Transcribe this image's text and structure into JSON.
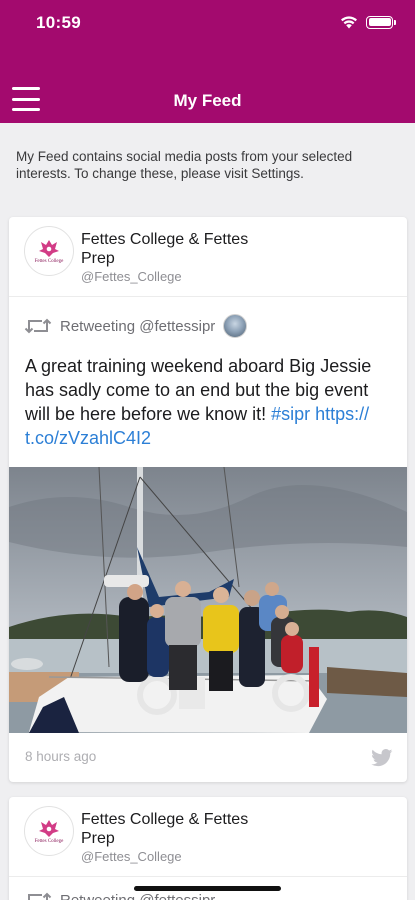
{
  "status_bar": {
    "time": "10:59"
  },
  "nav": {
    "title": "My Feed"
  },
  "intro": "My Feed contains social media posts from your selected interests. To change these, please visit Settings.",
  "posts": [
    {
      "author_name": "Fettes College & Fettes Prep",
      "handle": "@Fettes_College",
      "avatar_text": "Fettes College",
      "retweet_label": "Retweeting @fettessipr",
      "text_plain": "A great training weekend aboard Big Jessie has sadly come to an end but the big event will be here before we know it! ",
      "hashtag": "#sipr",
      "link": "https:// t.co/zVzahlC4I2",
      "time_ago": "8 hours ago"
    },
    {
      "author_name": "Fettes College & Fettes Prep",
      "handle": "@Fettes_College",
      "avatar_text": "Fettes College",
      "retweet_label": "Retweeting @fettessipr"
    }
  ],
  "colors": {
    "brand": "#a30a6e",
    "link": "#2c7fd6",
    "twitter_icon": "#c7c7cc"
  },
  "icons": [
    "wifi-icon",
    "battery-icon",
    "hamburger-menu-icon",
    "retweet-icon",
    "twitter-icon",
    "school-crest-icon"
  ]
}
